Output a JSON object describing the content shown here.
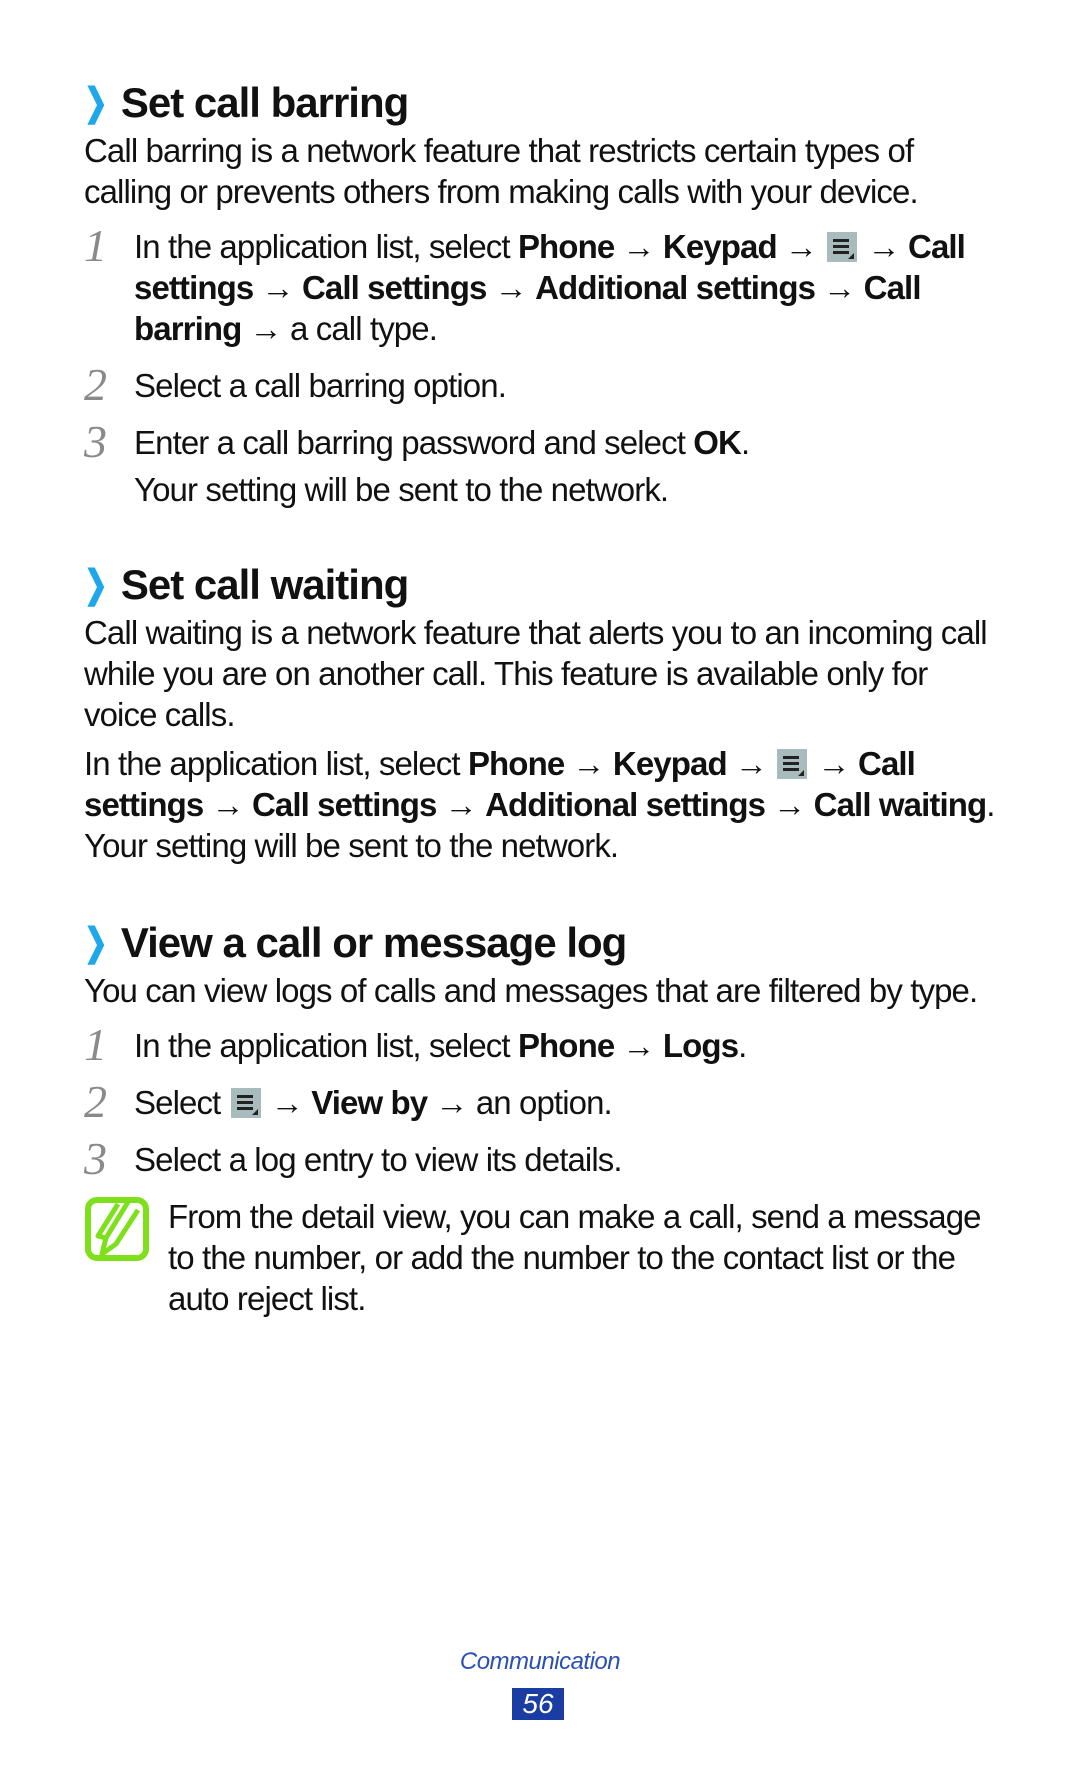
{
  "sections": [
    {
      "heading": "Set call barring",
      "intro": "Call barring is a network feature that restricts certain types of calling or prevents others from making calls with your device.",
      "steps": [
        {
          "num": "1",
          "parts": {
            "t1": "In the application list, select ",
            "b1": "Phone",
            "a1": " → ",
            "b2": "Keypad",
            "a2": " → ",
            "a3": " → ",
            "b3": "Call settings",
            "a4": " → ",
            "b4": "Call settings",
            "a5": " → ",
            "b5": "Additional settings",
            "a6": " → ",
            "b6": "Call barring",
            "t2": " → a call type."
          }
        },
        {
          "num": "2",
          "text": "Select a call barring option."
        },
        {
          "num": "3",
          "parts": {
            "t1": "Enter a call barring password and select ",
            "b1": "OK",
            "t2": "."
          },
          "sub": "Your setting will be sent to the network."
        }
      ]
    },
    {
      "heading": "Set call waiting",
      "intro": "Call waiting is a network feature that alerts you to an incoming call while you are on another call. This feature is available only for voice calls.",
      "instruction": {
        "t1": "In the application list, select ",
        "b1": "Phone",
        "a1": " → ",
        "b2": "Keypad",
        "a2": " → ",
        "a3": " → ",
        "b3": "Call settings",
        "a4": " → ",
        "b4": "Call settings",
        "a5": " → ",
        "b5": "Additional settings",
        "a6": " → ",
        "b6": "Call waiting",
        "t2": ". Your setting will be sent to the network."
      }
    },
    {
      "heading": "View a call or message log",
      "intro": "You can view logs of calls and messages that are filtered by type.",
      "steps": [
        {
          "num": "1",
          "parts": {
            "t1": "In the application list, select ",
            "b1": "Phone",
            "a1": " → ",
            "b2": "Logs",
            "t2": "."
          }
        },
        {
          "num": "2",
          "parts": {
            "t1": "Select ",
            "a1": " → ",
            "b1": "View by",
            "t2": " → an option."
          }
        },
        {
          "num": "3",
          "text": "Select a log entry to view its details."
        }
      ],
      "note": "From the detail view, you can make a call, send a message to the number, or add the number to the contact list or the auto reject list."
    }
  ],
  "icons": {
    "heading_marker": "chevron-right-icon",
    "menu_key": "menu-key-icon",
    "note": "note-pencil-icon"
  },
  "footer": {
    "chapter": "Communication",
    "page_number": "56"
  },
  "colors": {
    "accent_chevron": "#1ea7ea",
    "note_icon": "#7ee01a",
    "footer_text": "#2a4fb5",
    "page_badge": "#1a3da3",
    "menu_icon_bg": "#a9bcbd"
  }
}
